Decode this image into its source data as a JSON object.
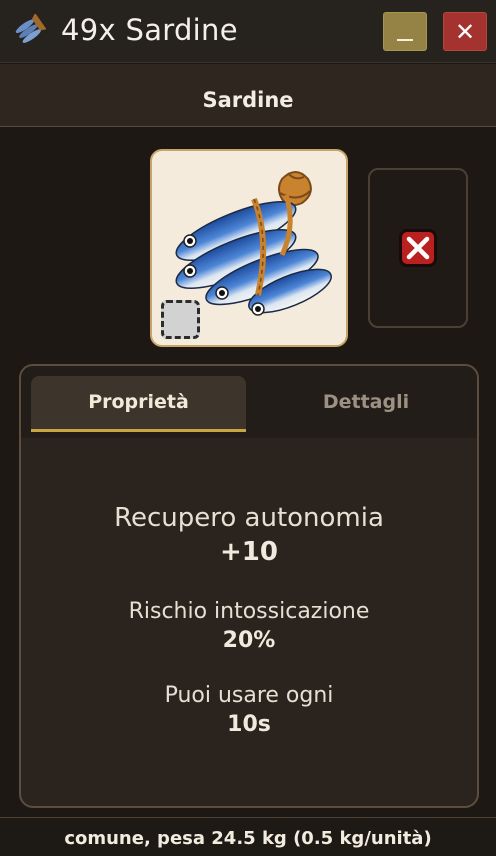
{
  "window": {
    "title": "49x Sardine",
    "title_icon": "sardine-bundle-icon",
    "minimize_label": "_",
    "close_label": "✕"
  },
  "item": {
    "name": "Sardine",
    "image": "sardine-bundle-image"
  },
  "tabs": [
    {
      "label": "Proprietà",
      "active": true
    },
    {
      "label": "Dettagli",
      "active": false
    }
  ],
  "stats": [
    {
      "label": "Recupero autonomia",
      "value": "+10"
    },
    {
      "label": "Rischio intossicazione",
      "value": "20%"
    },
    {
      "label": "Puoi usare ogni",
      "value": "10s"
    }
  ],
  "footer": {
    "text": "comune, pesa 24.5 kg (0.5 kg/unità)"
  },
  "colors": {
    "accent_gold": "#c9a545",
    "minimize_button": "#948344",
    "close_button": "#a4332f",
    "remove_button": "#b92020"
  }
}
